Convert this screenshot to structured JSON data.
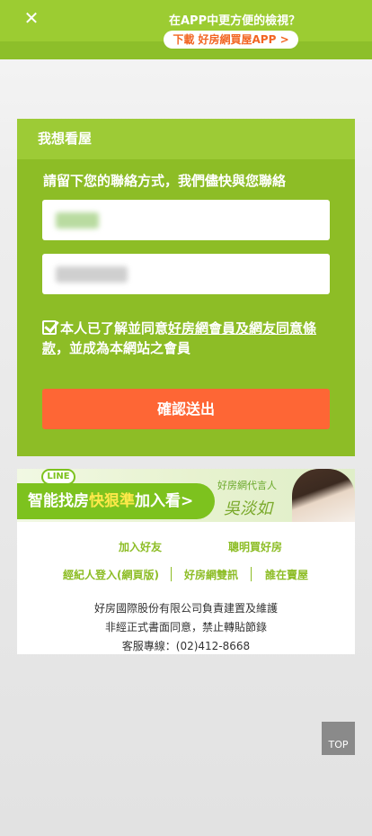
{
  "app_banner": {
    "close_icon": "close-icon",
    "promo_text": "在APP中更方便的檢視？",
    "download_label": "下載 好房網買屋APP >"
  },
  "form": {
    "title": "我想看屋",
    "intro": "請留下您的聯絡方式，我們儘快與您聯絡",
    "name_value": "",
    "phone_value": "",
    "agree_prefix": "本人已了解並同意",
    "agree_link": "好房網會員及網友同意條款",
    "agree_suffix": "，並成為本網站之會員",
    "agree_checked": true,
    "submit_label": "確認送出"
  },
  "line_banner": {
    "badge": "LINE",
    "slogan_a": "智能找房",
    "slogan_b": "快狠準",
    "slogan_c": "加入看>",
    "spokesperson": "好房網代言人",
    "signature": "吳淡如"
  },
  "footer": {
    "links_row1": [
      "加入好友",
      "聰明買好房"
    ],
    "links_row2": [
      "經紀人登入(網頁版)",
      "好房網雙訊",
      "誰在賣屋"
    ],
    "company": "好房國際股份有限公司負責建置及維護",
    "notice": "非經正式書面同意，禁止轉貼節錄",
    "hotline": "客服專線：(02)412-8668"
  },
  "top_button": "TOP",
  "colors": {
    "brand_green": "#8dbd26",
    "header_green": "#9dcb36",
    "submit_orange": "#fe6635"
  }
}
